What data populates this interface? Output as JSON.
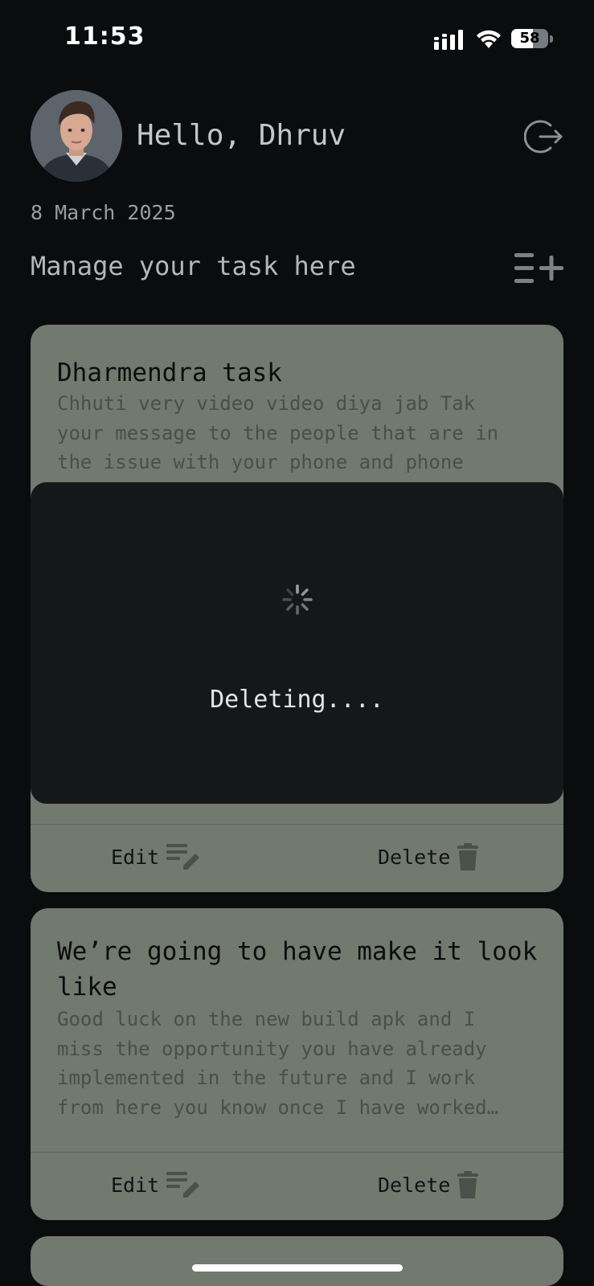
{
  "status_bar": {
    "time": "11:53",
    "battery_level": "58",
    "battery_fraction": 0.58,
    "icons": [
      "signal-icon",
      "wifi-icon",
      "battery-icon"
    ]
  },
  "header": {
    "greeting": "Hello, Dhruv",
    "avatar_icon": "avatar",
    "logout_icon": "logout-icon"
  },
  "date": "8 March 2025",
  "section": {
    "title": "Manage your task here",
    "add_icon": "add-task-icon"
  },
  "tasks": [
    {
      "title": "Dharmendra task",
      "description_lines": [
        "Chhuti very video video diya jab Tak",
        "your message to the people that are in",
        "the issue with your phone and phone"
      ],
      "edit_label": "Edit",
      "delete_label": "Delete"
    },
    {
      "title_lines": [
        "We’re going to have make it look",
        "like"
      ],
      "description_lines": [
        "Good luck on the new build apk and I",
        "miss the opportunity you have already",
        "implemented in the future and I work",
        "from here you know once I have worked…"
      ],
      "edit_label": "Edit",
      "delete_label": "Delete"
    }
  ],
  "loading_dialog": {
    "message": "Deleting...."
  },
  "colors": {
    "background": "#0b0c0e",
    "card": "#72796f",
    "dialog": "#161719",
    "text_light": "#c4c7c9"
  }
}
